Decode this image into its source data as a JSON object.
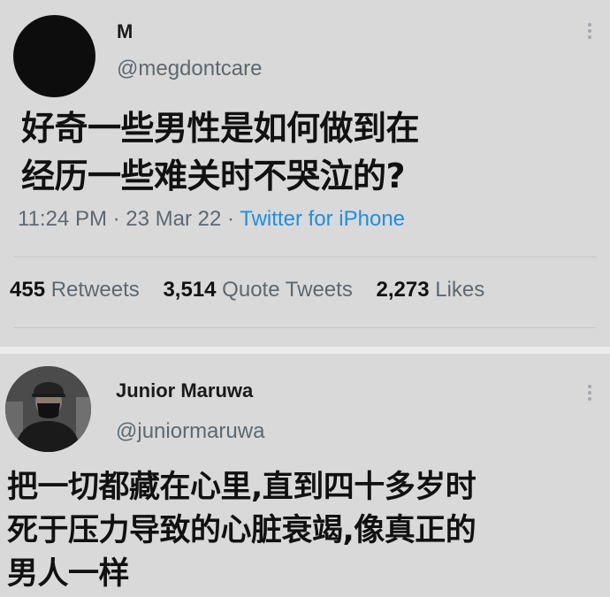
{
  "tweets": [
    {
      "author_name": "M",
      "handle": "@megdontcare",
      "text_lines": [
        "好奇一些男性是如何做到在",
        "经历一些难关时不哭泣的?"
      ],
      "time": "11:24 PM",
      "date": "23 Mar 22",
      "source": "Twitter for iPhone",
      "stats": {
        "retweets_count": "455",
        "retweets_label": "Retweets",
        "quotes_count": "3,514",
        "quotes_label": "Quote Tweets",
        "likes_count": "2,273",
        "likes_label": "Likes"
      }
    },
    {
      "author_name": "Junior Maruwa",
      "handle": "@juniormaruwa",
      "text_lines": [
        "把一切都藏在心里,直到四十多岁时",
        "死于压力导致的心脏衰竭,像真正的",
        "男人一样"
      ]
    }
  ],
  "separator": "·",
  "colors": {
    "card_background": "#d9d9d9",
    "gap_background": "#ececec",
    "link_blue": "#1d8fe0",
    "secondary_text": "#5e6871"
  },
  "icons": {
    "more": "vertical-ellipsis-icon"
  }
}
